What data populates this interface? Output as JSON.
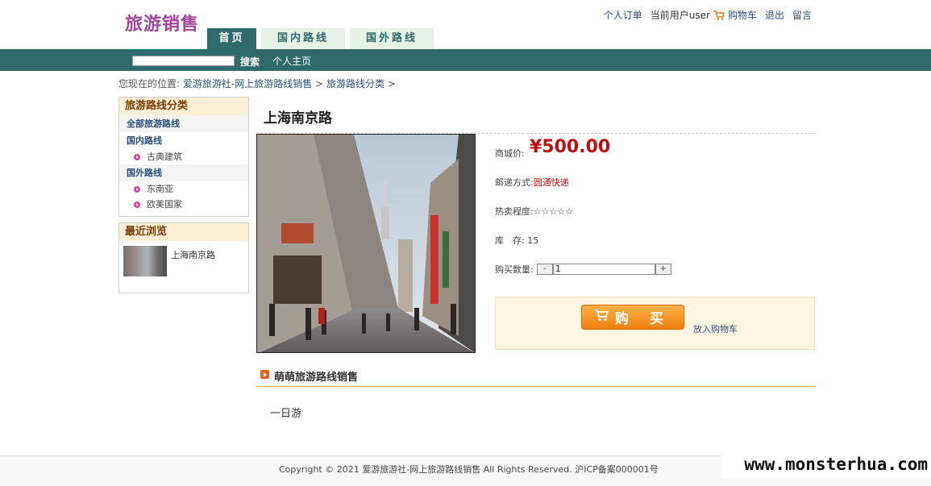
{
  "header": {
    "logo": "旅游销售",
    "top_links": {
      "orders": "个人订单",
      "current_user": "当前用户user",
      "cart": "购物车",
      "logout": "退出",
      "message": "留言"
    },
    "tabs": [
      {
        "label": "首页",
        "active": true
      },
      {
        "label": "国内路线",
        "active": false
      },
      {
        "label": "国外路线",
        "active": false
      }
    ],
    "search": {
      "value": "",
      "button": "搜索"
    },
    "home_link": "个人主页"
  },
  "breadcrumb": {
    "prefix": "您现在的位置:",
    "site": "爱游旅游社-网上旅游路线销售",
    "sep1": ">",
    "category": "旅游路线分类",
    "sep2": ">"
  },
  "sidebar": {
    "categories_title": "旅游路线分类",
    "all": "全部旅游路线",
    "domestic": "国内路线",
    "domestic_items": [
      "古典建筑"
    ],
    "foreign": "国外路线",
    "foreign_items": [
      "东南亚",
      "欧美国家"
    ],
    "recent_title": "最近浏览",
    "recent_item": "上海南京路"
  },
  "product": {
    "title": "上海南京路",
    "price_label": "商城价:",
    "price": "¥500.00",
    "ship_label": "邮递方式:",
    "ship_value": "圆通快递",
    "hot_label": "热卖程度:",
    "hot_value": "☆☆☆☆☆",
    "stock_label": "库　存:",
    "stock_value": "15",
    "qty_label": "购买数量:",
    "qty_minus": "-",
    "qty_value": "1",
    "qty_plus": "+",
    "buy_button": "购 买",
    "add_cart": "放入购物车"
  },
  "section": {
    "title": "萌萌旅游路线销售",
    "body": "一日游"
  },
  "footer": {
    "text": "Copyright © 2021 爱游旅游社-网上旅游路线销售 All Rights Reserved. 沪ICP备案000001号"
  },
  "watermark": "www.monsterhua.com",
  "colors": {
    "primary": "#2f6b6c",
    "price": "#c30d0d",
    "logo": "#a0479c",
    "buy_button": "#f07f0d"
  }
}
